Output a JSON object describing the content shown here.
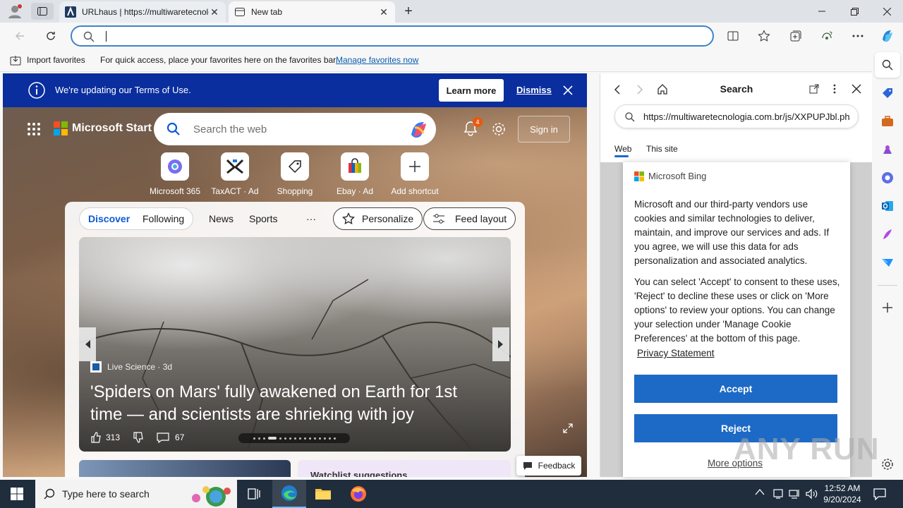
{
  "tabs": [
    {
      "title": "URLhaus | https://multiwaretecnologia.com.br"
    },
    {
      "title": "New tab"
    }
  ],
  "favorites_bar": {
    "import_label": "Import favorites",
    "hint": "For quick access, place your favorites here on the favorites bar.",
    "manage_link": "Manage favorites now"
  },
  "terms_banner": {
    "message": "We're updating our Terms of Use.",
    "learn_more": "Learn more",
    "dismiss": "Dismiss"
  },
  "start_page": {
    "brand": "Microsoft Start",
    "search_placeholder": "Search the web",
    "notification_count": "4",
    "sign_in": "Sign in",
    "shortcuts": [
      {
        "label": "Microsoft 365",
        "icon": "microsoft-365-icon"
      },
      {
        "label": "TaxACT · Ad",
        "icon": "taxact-icon"
      },
      {
        "label": "Shopping",
        "icon": "tag-icon"
      },
      {
        "label": "Ebay · Ad",
        "icon": "ebay-icon"
      },
      {
        "label": "Add shortcut",
        "icon": "plus-icon"
      }
    ],
    "feed_tabs": [
      "Discover",
      "Following",
      "News",
      "Sports",
      "···"
    ],
    "personalize": "Personalize",
    "feed_layout": "Feed layout",
    "hero": {
      "source": "Live Science · 3d",
      "headline": "'Spiders on Mars' fully awakened on Earth for 1st time — and scientists are shrieking with joy",
      "likes": "313",
      "comments": "67"
    },
    "next_card_title": "Watchlist suggestions",
    "feedback": "Feedback"
  },
  "side_panel": {
    "title": "Search",
    "query": "https://multiwaretecnologia.com.br/js/XXPUPJbl.php",
    "tabs": [
      "Web",
      "This site"
    ],
    "consent": {
      "brand": "Microsoft Bing",
      "para1": "Microsoft and our third-party vendors use cookies and similar technologies to deliver, maintain, and improve our services and ads. If you agree, we will use this data for ads personalization and associated analytics.",
      "para2": "You can select 'Accept' to consent to these uses, 'Reject' to decline these uses or click on 'More options' to review your options. You can change your selection under 'Manage Cookie Preferences' at the bottom of this page.",
      "privacy_link": "Privacy Statement",
      "accept": "Accept",
      "reject": "Reject",
      "more_options": "More options"
    }
  },
  "taskbar": {
    "search_placeholder": "Type here to search",
    "time": "12:52 AM",
    "date": "9/20/2024"
  },
  "watermark": "ANY RUN",
  "colors": {
    "banner": "#0a2e9e",
    "accent": "#1c6ac6",
    "address_border": "#3f84c9",
    "taskbar": "#1f2d3d"
  }
}
